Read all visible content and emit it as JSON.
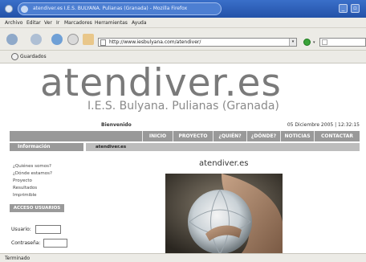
{
  "browser": {
    "window_title": "atendiver.es I.E.S. BULYANA. Pulianas (Granada) - Mozilla Firefox",
    "menu": [
      "Archivo",
      "Editar",
      "Ver",
      "Ir",
      "Marcadores",
      "Herramientas",
      "Ayuda"
    ],
    "url": "http://www.iesbulyana.com/atendiver/",
    "bookmark": "Guardados",
    "status": "Terminado"
  },
  "page": {
    "logo": "atendiver.es",
    "subtitle": "I.E.S. Bulyana. Pulianas (Granada)",
    "welcome": "Bienvenido",
    "date": "05 Diciembre 2005 | 12:32:15",
    "nav": [
      "INICIO",
      "PROYECTO",
      "¿QUIÉN?",
      "¿DÓNDE?",
      "NOTICIAS",
      "CONTACTAR"
    ],
    "left_header": "Información",
    "breadcrumb": "atendiver.es",
    "side_links": [
      "¿Quiénes somos?",
      "¿Dónde estamos?",
      "Proyecto",
      "Resultados",
      "Imprimible"
    ],
    "login_header": "ACCESO USUARIOS",
    "login_user_label": "Usuario:",
    "login_pass_label": "Contraseña:",
    "main_title": "atendiver.es"
  },
  "colors": {
    "titlebar": "#2f63bd",
    "nav_bg": "#999999",
    "logo": "#7a7a7a"
  }
}
